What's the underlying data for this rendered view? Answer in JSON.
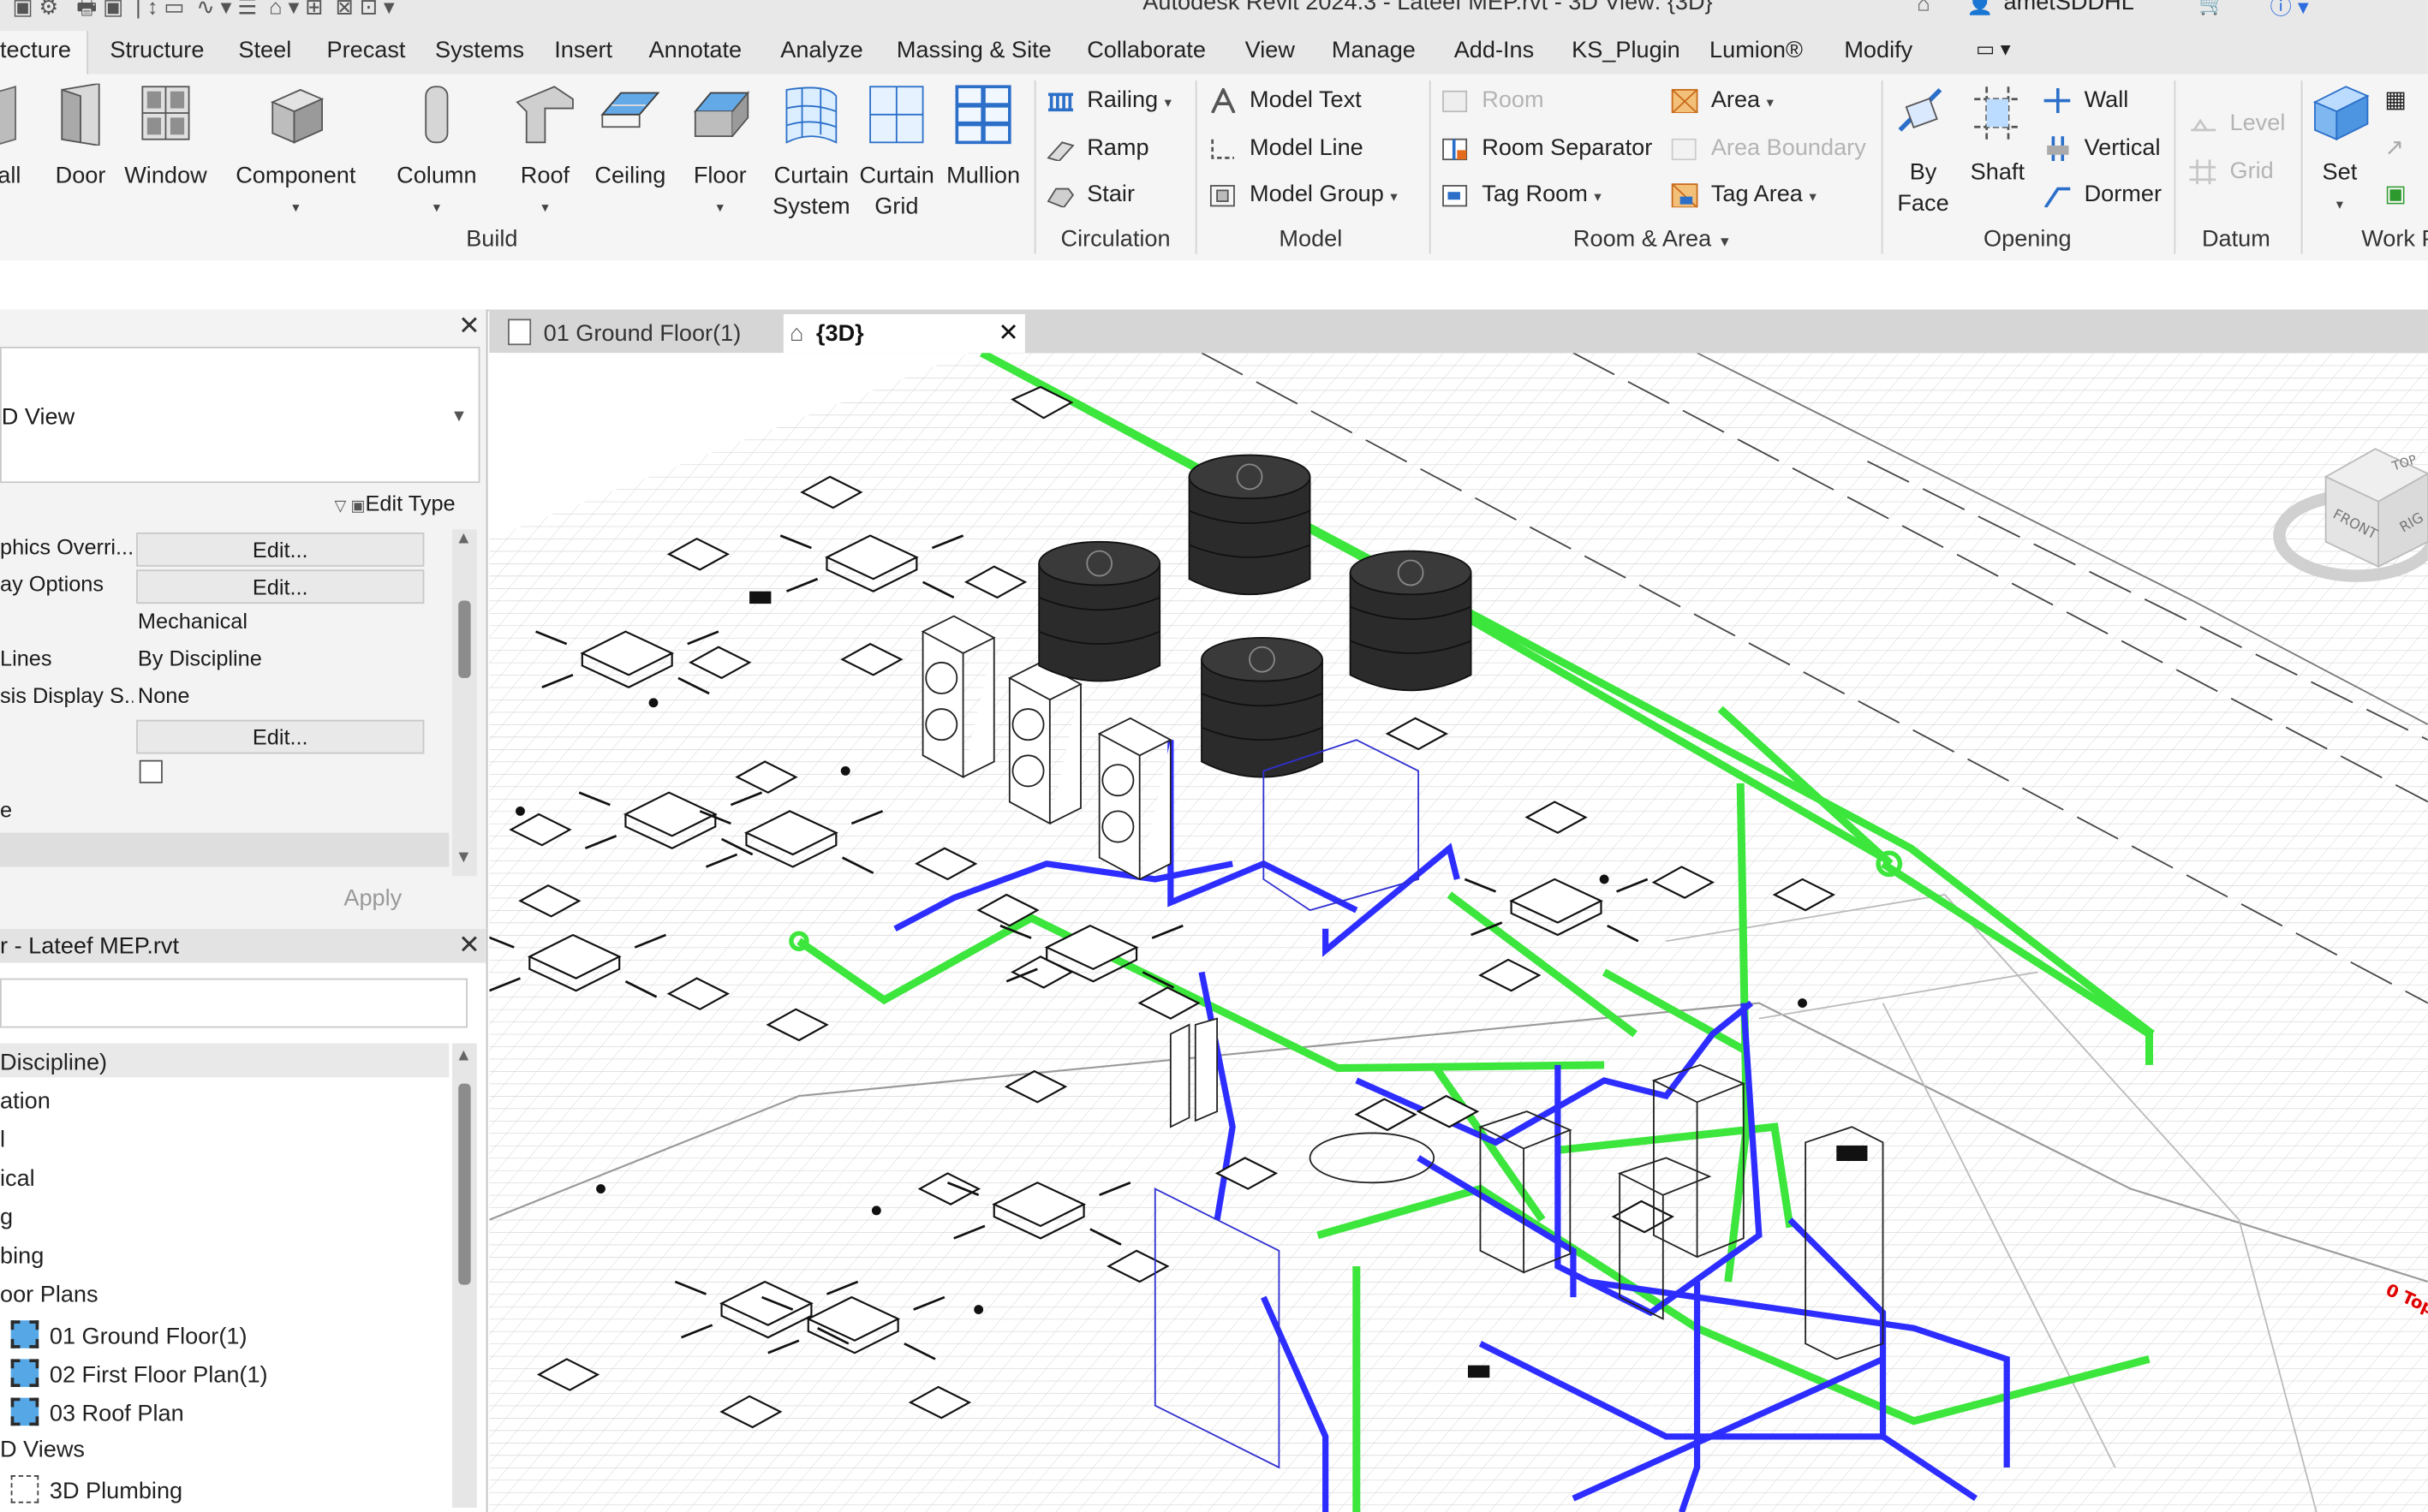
{
  "window": {
    "title": "Autodesk Revit 2024.3 - Lateef MEP.rvt - 3D View: {3D}",
    "user": "ametSDDHL"
  },
  "ribbon": {
    "tabs": [
      {
        "label": "tecture",
        "active": true
      },
      {
        "label": "Structure"
      },
      {
        "label": "Steel"
      },
      {
        "label": "Precast"
      },
      {
        "label": "Systems"
      },
      {
        "label": "Insert"
      },
      {
        "label": "Annotate"
      },
      {
        "label": "Analyze"
      },
      {
        "label": "Massing & Site"
      },
      {
        "label": "Collaborate"
      },
      {
        "label": "View"
      },
      {
        "label": "Manage"
      },
      {
        "label": "Add-Ins"
      },
      {
        "label": "KS_Plugin"
      },
      {
        "label": "Lumion®"
      },
      {
        "label": "Modify"
      }
    ],
    "build": {
      "wall": "all",
      "door": "Door",
      "window": "Window",
      "component": "Component",
      "column": "Column",
      "roof": "Roof",
      "ceiling": "Ceiling",
      "floor": "Floor",
      "curtain_system": [
        "Curtain",
        "System"
      ],
      "curtain_grid": [
        "Curtain",
        "Grid"
      ],
      "mullion": "Mullion",
      "label": "Build"
    },
    "circulation": {
      "railing": "Railing",
      "ramp": "Ramp",
      "stair": "Stair",
      "label": "Circulation"
    },
    "model": {
      "text": "Model  Text",
      "line": "Model  Line",
      "group": "Model  Group",
      "label": "Model"
    },
    "room_area": {
      "room": "Room",
      "room_separator": "Room  Separator",
      "tag_room": "Tag  Room",
      "area": "Area",
      "area_boundary": "Area  Boundary",
      "tag_area": "Tag  Area",
      "label": "Room & Area"
    },
    "opening": {
      "by_face": [
        "By",
        "Face"
      ],
      "shaft": "Shaft",
      "wall": "Wall",
      "vertical": "Vertical",
      "dormer": "Dormer",
      "label": "Opening"
    },
    "datum": {
      "level": "Level",
      "grid": "Grid",
      "label": "Datum"
    },
    "work": {
      "set": "Set",
      "label": "Work P"
    }
  },
  "properties": {
    "type": "D View",
    "edit_type": "Edit Type",
    "rows": [
      {
        "name": "phics Overri...",
        "button": "Edit..."
      },
      {
        "name": "ay Options",
        "button": "Edit..."
      },
      {
        "name": "",
        "value": "Mechanical"
      },
      {
        "name": "Lines",
        "value": "By Discipline"
      },
      {
        "name": "sis Display S...",
        "value": "None"
      },
      {
        "name": "",
        "button": "Edit..."
      },
      {
        "name": "",
        "checkbox": true
      },
      {
        "name": "e",
        "value": ""
      }
    ],
    "apply": "Apply"
  },
  "browser": {
    "title": "r - Lateef MEP.rvt",
    "items": [
      {
        "label": "Discipline)"
      },
      {
        "label": "ation"
      },
      {
        "label": "l"
      },
      {
        "label": "ical"
      },
      {
        "label": "g"
      },
      {
        "label": "bing"
      },
      {
        "label": "oor Plans"
      },
      {
        "label": "01 Ground Floor(1)",
        "icon": "floor-plan-icon"
      },
      {
        "label": "02 First Floor Plan(1)",
        "icon": "floor-plan-icon"
      },
      {
        "label": "03 Roof Plan",
        "icon": "floor-plan-icon"
      },
      {
        "label": "D Views"
      },
      {
        "label": "3D Plumbing",
        "icon": "3d-view-icon"
      }
    ]
  },
  "views": {
    "tabs": [
      {
        "label": "01 Ground Floor(1)",
        "icon": "floor-plan-icon"
      },
      {
        "label": "{3D}",
        "icon": "house-icon",
        "active": true
      }
    ]
  },
  "viewcube": {
    "top": "TOP",
    "front": "FRONT",
    "right": "RIG"
  },
  "canvas": {
    "level_tag": "0 Top"
  },
  "colors": {
    "cold_pipe": "#2d2dff",
    "hot_pipe": "#3ce63c",
    "tank": "#2b2b2b",
    "level_tag": "#e00000"
  }
}
